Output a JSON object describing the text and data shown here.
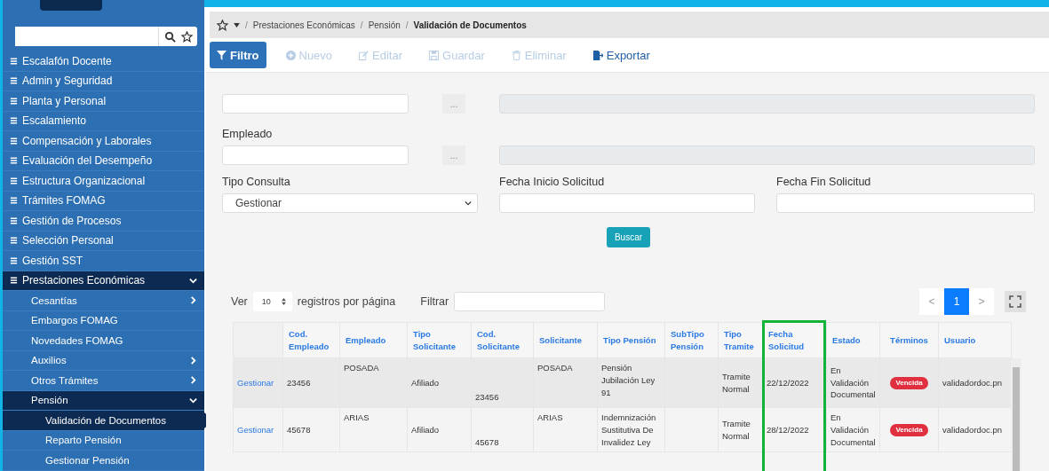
{
  "sidebar": {
    "items": [
      {
        "label": "Escalafón Docente",
        "selected": false
      },
      {
        "label": "Admin y Seguridad",
        "selected": false
      },
      {
        "label": "Planta y Personal",
        "selected": false
      },
      {
        "label": "Escalamiento",
        "selected": false
      },
      {
        "label": "Compensación y Laborales",
        "selected": false
      },
      {
        "label": "Evaluación del Desempeño",
        "selected": false
      },
      {
        "label": "Estructura Organizacional",
        "selected": false
      },
      {
        "label": "Trámites FOMAG",
        "selected": false
      },
      {
        "label": "Gestión de Procesos",
        "selected": false
      },
      {
        "label": "Selección Personal",
        "selected": false
      },
      {
        "label": "Gestión SST",
        "selected": false
      },
      {
        "label": "Prestaciones Económicas",
        "selected": false,
        "expanded": true,
        "children": [
          {
            "label": "Cesantías",
            "selected": false,
            "expanded": false
          },
          {
            "label": "Embargos FOMAG",
            "selected": false
          },
          {
            "label": "Novedades FOMAG",
            "selected": false
          },
          {
            "label": "Auxilios",
            "selected": false,
            "expanded": false
          },
          {
            "label": "Otros Trámites",
            "selected": false,
            "expanded": false
          },
          {
            "label": "Pensión",
            "selected": false,
            "expanded": true,
            "children": [
              {
                "label": "Validación de Documentos",
                "selected": true
              },
              {
                "label": "Reparto Pensión",
                "selected": false
              },
              {
                "label": "Gestionar Pensión",
                "selected": false
              }
            ]
          }
        ]
      }
    ]
  },
  "breadcrumb": {
    "separator": "/",
    "items": [
      "Prestaciones Económicas",
      "Pensión",
      "Validación de Documentos"
    ]
  },
  "toolbar": [
    {
      "label": "Filtro",
      "kind": "filter",
      "active": true,
      "disabled": false
    },
    {
      "label": "Nuevo",
      "kind": "new",
      "active": false,
      "disabled": true
    },
    {
      "label": "Editar",
      "kind": "edit",
      "active": false,
      "disabled": true
    },
    {
      "label": "Guardar",
      "kind": "save",
      "active": false,
      "disabled": true
    },
    {
      "label": "Eliminar",
      "kind": "delete",
      "active": false,
      "disabled": true
    },
    {
      "label": "Exportar",
      "kind": "export",
      "active": false,
      "disabled": false
    }
  ],
  "form": {
    "employee_label": "Empleado",
    "lookup_button": "...",
    "tipo_consulta": {
      "label": "Tipo Consulta",
      "value": "Gestionar"
    },
    "fecha_inicio": {
      "label": "Fecha Inicio Solicitud"
    },
    "fecha_fin": {
      "label": "Fecha Fin Solicitud"
    },
    "search_button": "Buscar"
  },
  "table_controls": {
    "show_label": "Ver",
    "page_size": "10",
    "per_page_label": "registros por página",
    "filter_label": "Filtrar",
    "pages": [
      {
        "label": "<",
        "selected": false
      },
      {
        "label": "1",
        "selected": true
      },
      {
        "label": ">",
        "selected": false
      }
    ]
  },
  "table": {
    "columns": [
      {
        "kind": "link"
      },
      {
        "label": "Cod. Empleado",
        "kind": "text"
      },
      {
        "label": "Empleado",
        "kind": "text"
      },
      {
        "label": "Tipo Solicitante",
        "kind": "text"
      },
      {
        "label": "Cod. Solicitante",
        "kind": "text"
      },
      {
        "label": "Solicitante",
        "kind": "text"
      },
      {
        "label": "Tipo Pensión",
        "kind": "text"
      },
      {
        "label": "SubTipo Pensión",
        "kind": "text"
      },
      {
        "label": "Tipo Tramite",
        "kind": "text"
      },
      {
        "label": "Fecha Solicitud",
        "kind": "text"
      },
      {
        "label": "Estado",
        "kind": "text"
      },
      {
        "label": "Términos",
        "kind": "badge"
      },
      {
        "label": "Usuario",
        "kind": "text"
      }
    ],
    "rows": [
      {
        "cells": [
          "Gestionar",
          "23456",
          "POSADA",
          "Afiliado",
          "23456",
          "POSADA",
          "Pensión Jubilación Ley 91",
          "",
          "Tramite Normal",
          "22/12/2022",
          "En Validación Documental",
          "Vencida",
          "validadordoc.pn"
        ]
      },
      {
        "cells": [
          "Gestionar",
          "45678",
          "ARIAS",
          "Afiliado",
          "45678",
          "ARIAS",
          "Indemnización Sustitutiva De Invalidez Ley",
          "",
          "Tramite Normal",
          "28/12/2022",
          "En Validación Documental",
          "Vencida",
          "validadordoc.pn"
        ]
      }
    ]
  }
}
